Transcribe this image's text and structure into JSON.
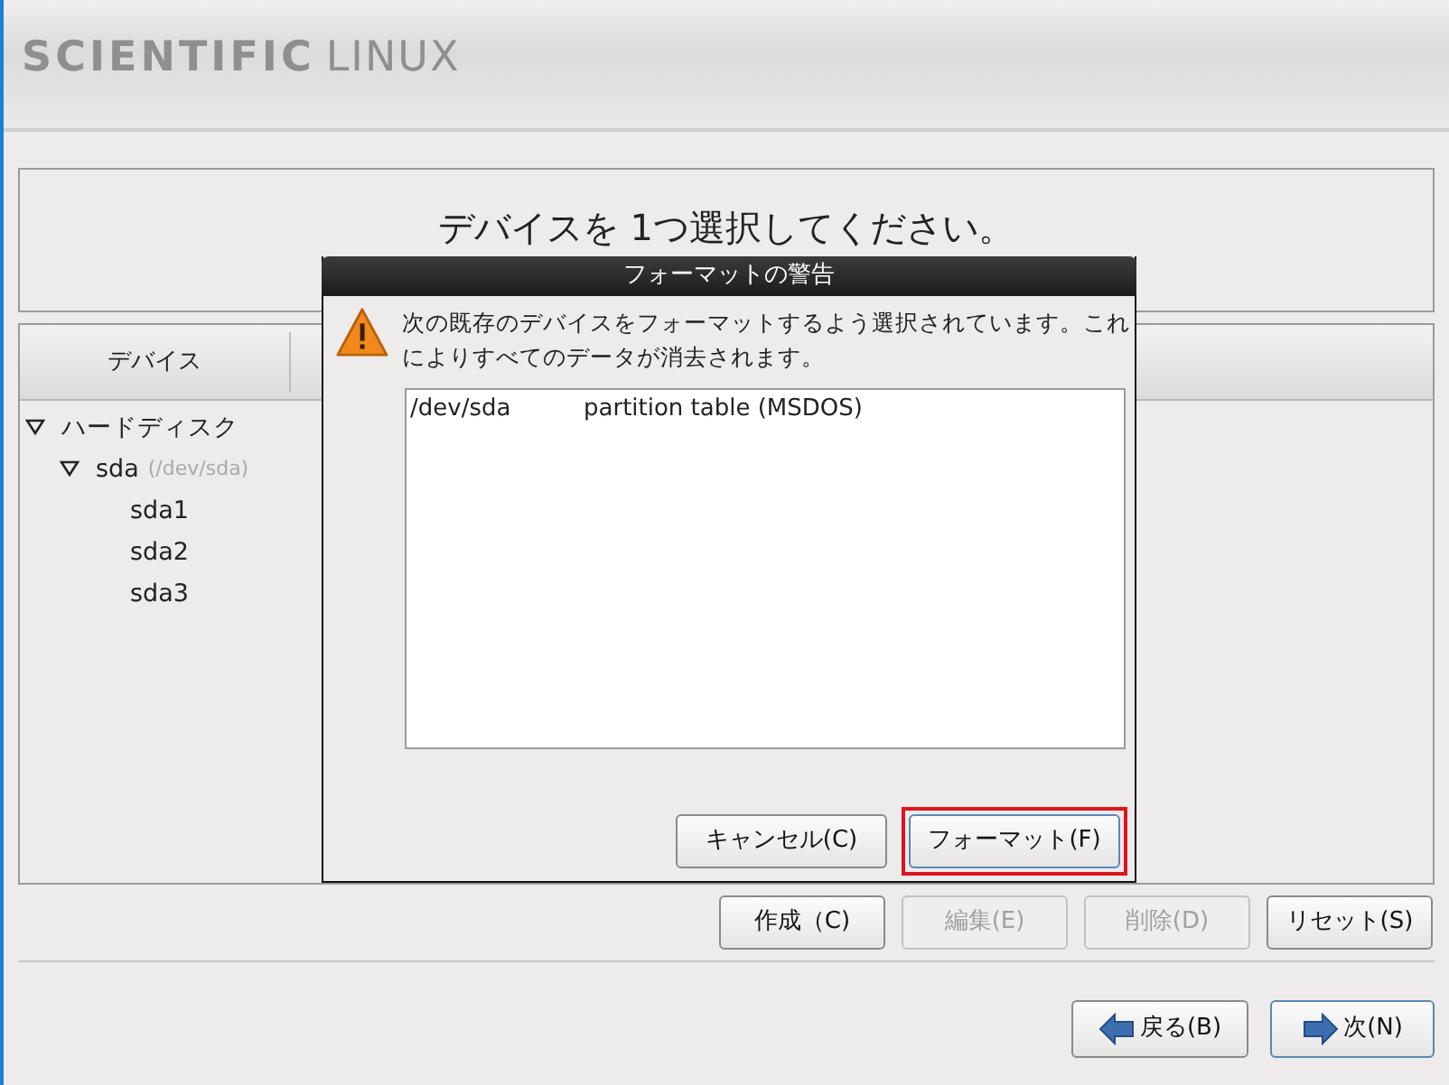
{
  "header": {
    "logo_bold": "SCIENTIFIC",
    "logo_light": "LINUX"
  },
  "heading": "デバイスを 1つ選択してください。",
  "device_table": {
    "columns": [
      {
        "label": "デバイス"
      }
    ],
    "rows": [
      {
        "name": "ハードディスク",
        "expanded": true,
        "children": [
          {
            "name": "sda",
            "path": "(/dev/sda)",
            "expanded": true,
            "children": [
              {
                "name": "sda1"
              },
              {
                "name": "sda2"
              },
              {
                "name": "sda3"
              }
            ]
          }
        ]
      }
    ]
  },
  "action_buttons": [
    {
      "label": "作成（C)",
      "disabled": false
    },
    {
      "label": "編集(E)",
      "disabled": true
    },
    {
      "label": "削除(D)",
      "disabled": true
    },
    {
      "label": "リセット(S)",
      "disabled": false
    }
  ],
  "nav_buttons": [
    {
      "label": "戻る(B)",
      "kind": "back",
      "focused": false
    },
    {
      "label": "次(N)",
      "kind": "next",
      "focused": true
    }
  ],
  "dialog": {
    "title": "フォーマットの警告",
    "message": "次の既存のデバイスをフォーマットするよう選択されています。これによりすべてのデータが消去されます。",
    "items": [
      {
        "device": "/dev/sda",
        "description": "partition table (MSDOS)"
      }
    ],
    "buttons": [
      {
        "label": "キャンセル(C)",
        "focused": false
      },
      {
        "label": "フォーマット(F)",
        "focused": true
      }
    ]
  }
}
